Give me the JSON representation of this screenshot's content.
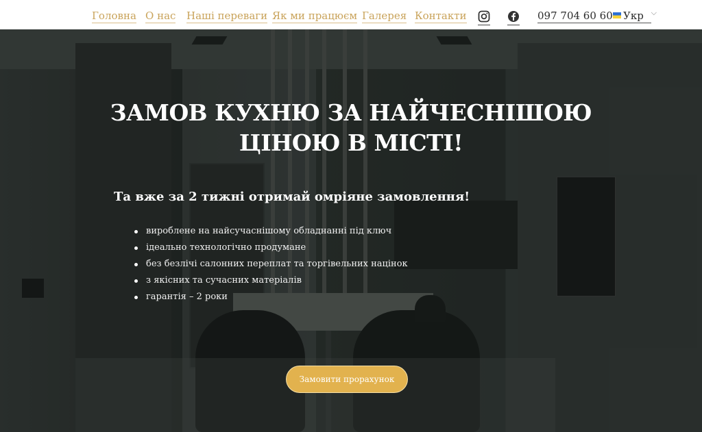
{
  "header": {
    "nav": [
      {
        "label": "Головна"
      },
      {
        "label": "О нас"
      },
      {
        "label": "Наші переваги"
      },
      {
        "label": "Як ми працюєм"
      },
      {
        "label": "Галерея"
      },
      {
        "label": "Контакти"
      }
    ],
    "social_icons": [
      "instagram-icon",
      "facebook-icon"
    ],
    "phone": "097 704 60 60",
    "language": "Укр"
  },
  "hero": {
    "title_line1": "ЗАМОВ КУХНЮ ЗА НАЙЧЕСНІШОЮ",
    "title_line2": "ЦІНОЮ В МІСТІ!",
    "subtitle": "Та вже за 2 тижні отримай омріяне замовлення!",
    "features": [
      "виробленe на найсучаснішому обладнанні під ключ",
      "ідеально технологічно продумане",
      "без безлічі салонних переплат та торгівельних націнок",
      "з якісних та сучасних матеріалів",
      "гарантія – 2 роки"
    ],
    "cta_label": "Замовити прорахунок"
  },
  "colors": {
    "accent": "#e2b24e",
    "nav_link": "#c9a35a"
  }
}
